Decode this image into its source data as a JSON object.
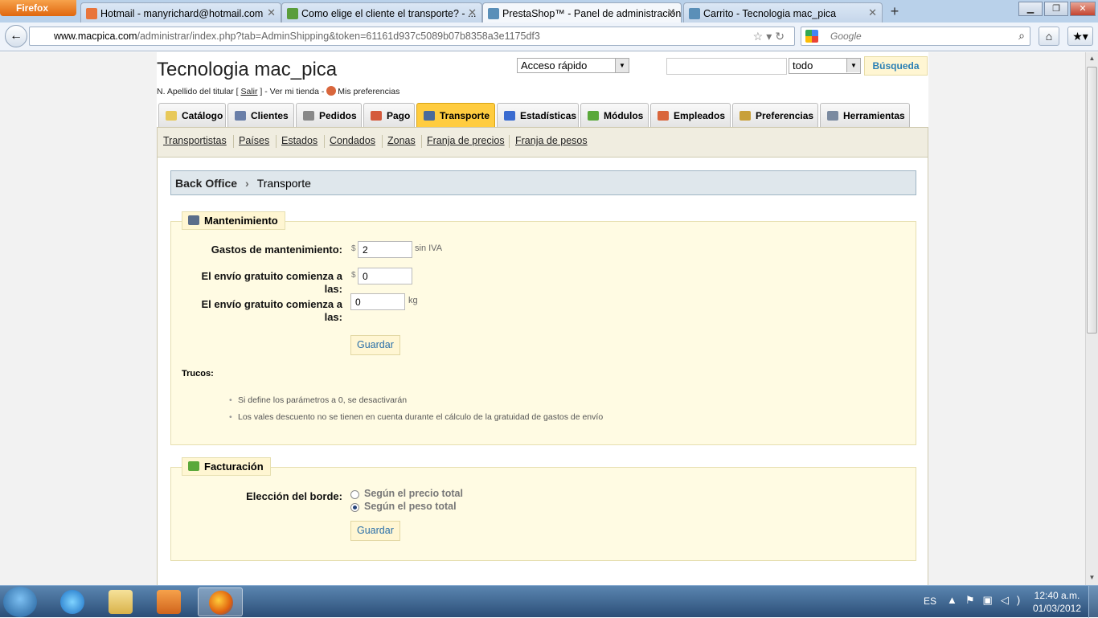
{
  "browser": {
    "menu_label": "Firefox",
    "tabs": [
      {
        "title": "Hotmail - manyrichard@hotmail.com",
        "favicon_color": "#e8743b"
      },
      {
        "title": "Como elige el cliente el transporte? - ...",
        "favicon_color": "#5a9d3b"
      },
      {
        "title": "PrestaShop™ - Panel de administración",
        "favicon_color": "#5a8fb8"
      },
      {
        "title": "Carrito - Tecnologia mac_pica",
        "favicon_color": "#5a8fb8"
      }
    ],
    "active_tab": 2,
    "new_tab": "+",
    "url_host": "www.macpica.com",
    "url_path": "/administrar/index.php?tab=AdminShipping&token=61161d937c5089b07b8358a3e1175df3",
    "search_placeholder": "Google"
  },
  "header": {
    "shop_name": "Tecnologia mac_pica",
    "user_prefix": "N. Apellido del titular [",
    "logout": "Salir",
    "user_mid": "] - Ver mi tienda -",
    "preferences": "Mis preferencias",
    "quick_access": "Acceso rápido",
    "search_scope": "todo",
    "search_button": "Búsqueda"
  },
  "main_tabs": [
    {
      "label": "Catálogo",
      "icon": "folder-icon",
      "color": "#e8c95a"
    },
    {
      "label": "Clientes",
      "icon": "person-icon",
      "color": "#6a7fa8"
    },
    {
      "label": "Pedidos",
      "icon": "cart-icon",
      "color": "#888888"
    },
    {
      "label": "Pago",
      "icon": "payment-icon",
      "color": "#d45a3c"
    },
    {
      "label": "Transporte",
      "icon": "truck-icon",
      "color": "#4a6a9a"
    },
    {
      "label": "Estadísticas",
      "icon": "chart-icon",
      "color": "#3a6bd0"
    },
    {
      "label": "Módulos",
      "icon": "puzzle-icon",
      "color": "#5aa83a"
    },
    {
      "label": "Empleados",
      "icon": "employee-icon",
      "color": "#d9663c"
    },
    {
      "label": "Preferencias",
      "icon": "settings-icon",
      "color": "#c8a03a"
    },
    {
      "label": "Herramientas",
      "icon": "wrench-icon",
      "color": "#7a8aa0"
    }
  ],
  "active_main_tab": 4,
  "sub_tabs": [
    "Transportistas",
    "Países",
    "Estados",
    "Condados",
    "Zonas",
    "Franja de precios",
    "Franja de pesos"
  ],
  "breadcrumb": {
    "root": "Back Office",
    "current": "Transporte"
  },
  "maintenance": {
    "legend": "Mantenimiento",
    "fields": [
      {
        "label": "Gastos de mantenimiento:",
        "currency": "$",
        "value": "2",
        "unit": "sin IVA"
      },
      {
        "label": "El envío gratuito comienza a las:",
        "currency": "$",
        "value": "0",
        "unit": ""
      },
      {
        "label": "El envío gratuito comienza a las:",
        "currency": "",
        "value": "0",
        "unit": "kg"
      }
    ],
    "save": "Guardar",
    "tips_title": "Trucos:",
    "tips": [
      "Si define los parámetros a 0, se desactivarán",
      "Los vales descuento no se tienen en cuenta durante el cálculo de la gratuidad de gastos de envío"
    ]
  },
  "billing": {
    "legend": "Facturación",
    "label": "Elección del borde:",
    "options": [
      "Según el precio total",
      "Según el peso total"
    ],
    "selected": 1,
    "save": "Guardar"
  },
  "taskbar": {
    "lang": "ES",
    "time": "12:40 a.m.",
    "date": "01/03/2012"
  }
}
